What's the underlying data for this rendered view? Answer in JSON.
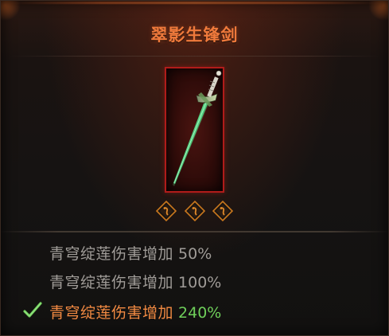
{
  "item": {
    "title": "翠影生锋剑",
    "icon": "jade-sword-icon",
    "socket_icon": "rune-socket-icon",
    "socket_count": 3,
    "frame_color": "#b01c1a",
    "title_color": "#f07a3c"
  },
  "affixes": [
    {
      "name": "青穹绽莲伤害增加",
      "value": "50%",
      "active": false
    },
    {
      "name": "青穹绽莲伤害增加",
      "value": "100%",
      "active": false
    },
    {
      "name": "青穹绽莲伤害增加",
      "value": "240%",
      "active": true
    }
  ],
  "colors": {
    "active_name": "#f28a42",
    "active_value": "#6fcf5a",
    "inactive_text": "#a09c98",
    "check": "#6fcf5a"
  },
  "indicator_icon": "checkmark-icon"
}
